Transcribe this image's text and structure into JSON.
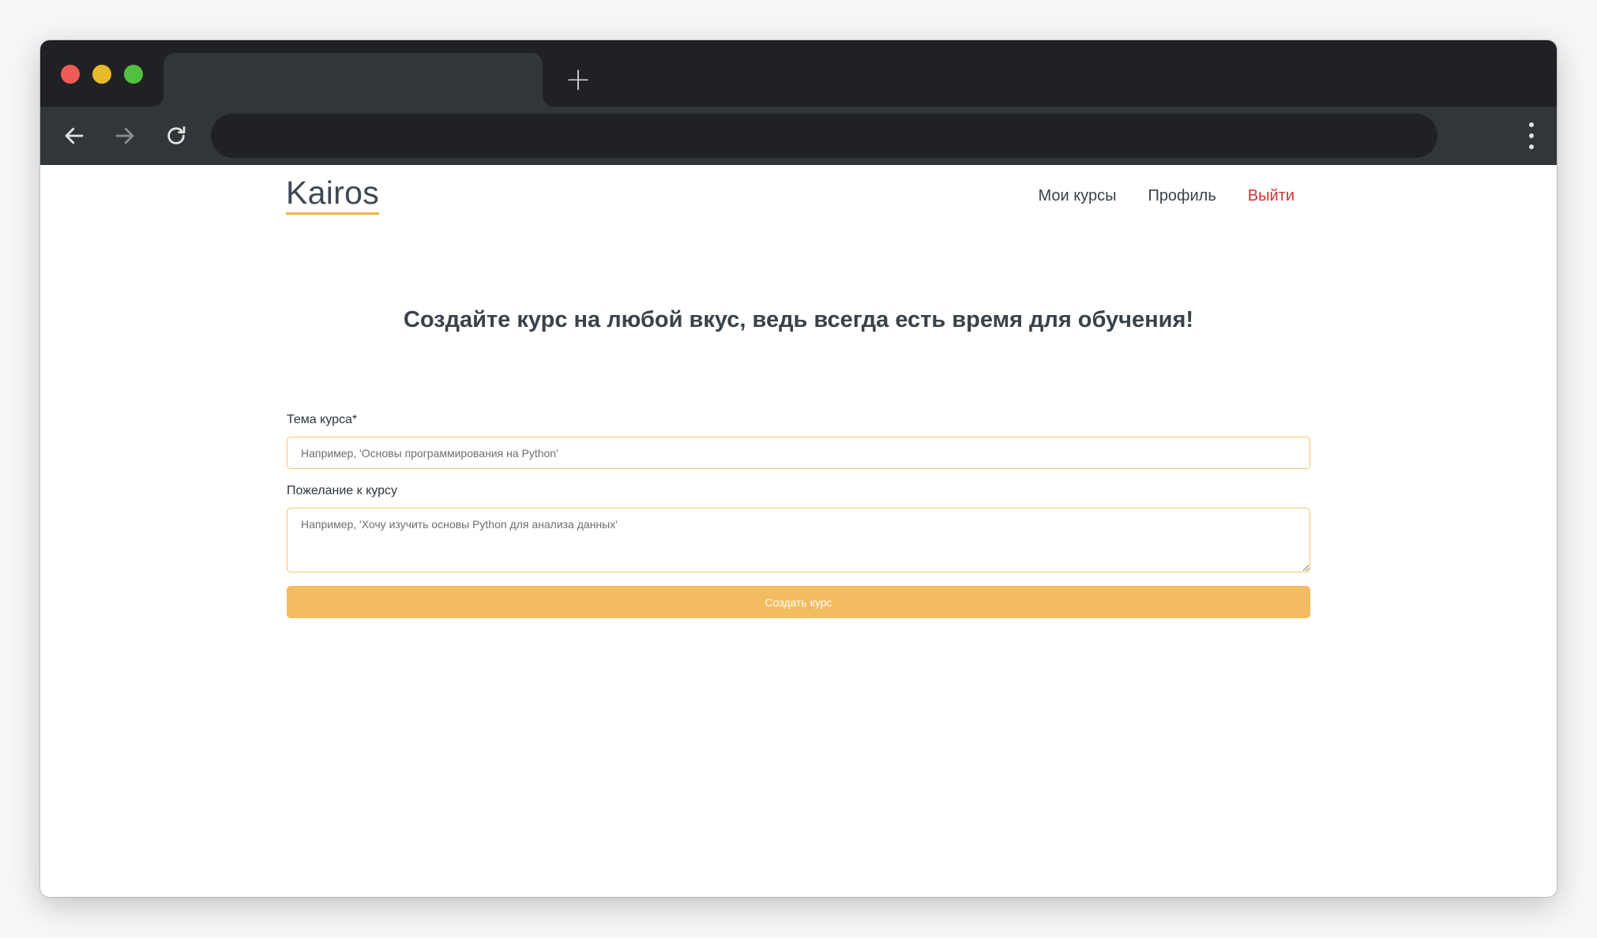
{
  "browser": {
    "tab_title": "",
    "new_tab_symbol": "+",
    "address": "",
    "icons": [
      "back-arrow-icon",
      "forward-arrow-icon",
      "reload-icon",
      "kebab-menu-icon"
    ]
  },
  "header": {
    "logo": "Kairos",
    "nav": {
      "my_courses": "Мои курсы",
      "profile": "Профиль",
      "logout": "Выйти"
    }
  },
  "main": {
    "headline": "Создайте курс на любой вкус, ведь всегда есть время для обучения!",
    "form": {
      "topic_label": "Тема курса*",
      "topic_value": "",
      "topic_placeholder": "Например, 'Основы программирования на Python'",
      "wish_label": "Пожелание к курсу",
      "wish_value": "",
      "wish_placeholder": "Например, 'Хочу изучить основы Python для анализа данных'",
      "submit_label": "Создать курс"
    }
  },
  "colors": {
    "accent": "#f3bc61",
    "input_border": "#f4c46a",
    "logout": "#d62f35",
    "text": "#3a4149"
  }
}
